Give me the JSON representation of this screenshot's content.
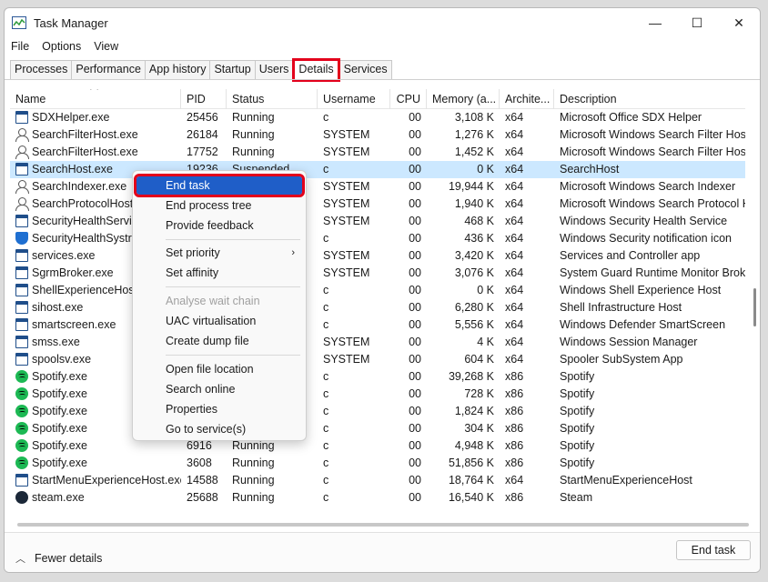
{
  "window": {
    "title": "Task Manager",
    "minimize": "—",
    "maximize": "☐",
    "close": "✕"
  },
  "menu": [
    "File",
    "Options",
    "View"
  ],
  "tabs": [
    "Processes",
    "Performance",
    "App history",
    "Startup",
    "Users",
    "Details",
    "Services"
  ],
  "active_tab": "Details",
  "columns": [
    "Name",
    "PID",
    "Status",
    "Username",
    "CPU",
    "Memory (a...",
    "Archite...",
    "Description"
  ],
  "rows": [
    {
      "icon": "app",
      "name": "SDXHelper.exe",
      "pid": "25456",
      "status": "Running",
      "user": "c",
      "cpu": "00",
      "mem": "3,108 K",
      "arch": "x64",
      "desc": "Microsoft Office SDX Helper"
    },
    {
      "icon": "user",
      "name": "SearchFilterHost.exe",
      "pid": "26184",
      "status": "Running",
      "user": "SYSTEM",
      "cpu": "00",
      "mem": "1,276 K",
      "arch": "x64",
      "desc": "Microsoft Windows Search Filter Host"
    },
    {
      "icon": "user",
      "name": "SearchFilterHost.exe",
      "pid": "17752",
      "status": "Running",
      "user": "SYSTEM",
      "cpu": "00",
      "mem": "1,452 K",
      "arch": "x64",
      "desc": "Microsoft Windows Search Filter Host"
    },
    {
      "icon": "app",
      "name": "SearchHost.exe",
      "pid": "19236",
      "status": "Suspended",
      "user": "c",
      "cpu": "00",
      "mem": "0 K",
      "arch": "x64",
      "desc": "SearchHost",
      "selected": true
    },
    {
      "icon": "user",
      "name": "SearchIndexer.exe",
      "pid": "",
      "status": "",
      "user": "SYSTEM",
      "cpu": "00",
      "mem": "19,944 K",
      "arch": "x64",
      "desc": "Microsoft Windows Search Indexer"
    },
    {
      "icon": "user",
      "name": "SearchProtocolHost.e",
      "pid": "",
      "status": "",
      "user": "SYSTEM",
      "cpu": "00",
      "mem": "1,940 K",
      "arch": "x64",
      "desc": "Microsoft Windows Search Protocol Ho"
    },
    {
      "icon": "app",
      "name": "SecurityHealthService",
      "pid": "",
      "status": "",
      "user": "SYSTEM",
      "cpu": "00",
      "mem": "468 K",
      "arch": "x64",
      "desc": "Windows Security Health Service"
    },
    {
      "icon": "shield",
      "name": "SecurityHealthSystray",
      "pid": "",
      "status": "",
      "user": "c",
      "cpu": "00",
      "mem": "436 K",
      "arch": "x64",
      "desc": "Windows Security notification icon"
    },
    {
      "icon": "app",
      "name": "services.exe",
      "pid": "",
      "status": "",
      "user": "SYSTEM",
      "cpu": "00",
      "mem": "3,420 K",
      "arch": "x64",
      "desc": "Services and Controller app"
    },
    {
      "icon": "app",
      "name": "SgrmBroker.exe",
      "pid": "",
      "status": "",
      "user": "SYSTEM",
      "cpu": "00",
      "mem": "3,076 K",
      "arch": "x64",
      "desc": "System Guard Runtime Monitor Broker"
    },
    {
      "icon": "app",
      "name": "ShellExperienceHost.e",
      "pid": "",
      "status": "",
      "user": "c",
      "cpu": "00",
      "mem": "0 K",
      "arch": "x64",
      "desc": "Windows Shell Experience Host"
    },
    {
      "icon": "app",
      "name": "sihost.exe",
      "pid": "",
      "status": "",
      "user": "c",
      "cpu": "00",
      "mem": "6,280 K",
      "arch": "x64",
      "desc": "Shell Infrastructure Host"
    },
    {
      "icon": "app",
      "name": "smartscreen.exe",
      "pid": "",
      "status": "",
      "user": "c",
      "cpu": "00",
      "mem": "5,556 K",
      "arch": "x64",
      "desc": "Windows Defender SmartScreen"
    },
    {
      "icon": "app",
      "name": "smss.exe",
      "pid": "",
      "status": "",
      "user": "SYSTEM",
      "cpu": "00",
      "mem": "4 K",
      "arch": "x64",
      "desc": "Windows Session Manager"
    },
    {
      "icon": "app",
      "name": "spoolsv.exe",
      "pid": "",
      "status": "",
      "user": "SYSTEM",
      "cpu": "00",
      "mem": "604 K",
      "arch": "x64",
      "desc": "Spooler SubSystem App"
    },
    {
      "icon": "spotify",
      "name": "Spotify.exe",
      "pid": "",
      "status": "",
      "user": "c",
      "cpu": "00",
      "mem": "39,268 K",
      "arch": "x86",
      "desc": "Spotify"
    },
    {
      "icon": "spotify",
      "name": "Spotify.exe",
      "pid": "",
      "status": "",
      "user": "c",
      "cpu": "00",
      "mem": "728 K",
      "arch": "x86",
      "desc": "Spotify"
    },
    {
      "icon": "spotify",
      "name": "Spotify.exe",
      "pid": "",
      "status": "",
      "user": "c",
      "cpu": "00",
      "mem": "1,824 K",
      "arch": "x86",
      "desc": "Spotify"
    },
    {
      "icon": "spotify",
      "name": "Spotify.exe",
      "pid": "",
      "status": "",
      "user": "c",
      "cpu": "00",
      "mem": "304 K",
      "arch": "x86",
      "desc": "Spotify"
    },
    {
      "icon": "spotify",
      "name": "Spotify.exe",
      "pid": "6916",
      "status": "Running",
      "user": "c",
      "cpu": "00",
      "mem": "4,948 K",
      "arch": "x86",
      "desc": "Spotify"
    },
    {
      "icon": "spotify",
      "name": "Spotify.exe",
      "pid": "3608",
      "status": "Running",
      "user": "c",
      "cpu": "00",
      "mem": "51,856 K",
      "arch": "x86",
      "desc": "Spotify"
    },
    {
      "icon": "app",
      "name": "StartMenuExperienceHost.exe",
      "pid": "14588",
      "status": "Running",
      "user": "c",
      "cpu": "00",
      "mem": "18,764 K",
      "arch": "x64",
      "desc": "StartMenuExperienceHost"
    },
    {
      "icon": "steam",
      "name": "steam.exe",
      "pid": "25688",
      "status": "Running",
      "user": "c",
      "cpu": "00",
      "mem": "16,540 K",
      "arch": "x86",
      "desc": "Steam"
    }
  ],
  "context_menu": {
    "end_task": "End task",
    "end_process_tree": "End process tree",
    "provide_feedback": "Provide feedback",
    "set_priority": "Set priority",
    "set_affinity": "Set affinity",
    "analyse_wait_chain": "Analyse wait chain",
    "uac_virtualisation": "UAC virtualisation",
    "create_dump_file": "Create dump file",
    "open_file_location": "Open file location",
    "search_online": "Search online",
    "properties": "Properties",
    "go_to_services": "Go to service(s)",
    "submenu_arrow": "›"
  },
  "footer": {
    "fewer_details": "Fewer details",
    "end_task_button": "End task",
    "chevron": "︿"
  },
  "colors": {
    "highlight_outline": "#e3001b",
    "selected_row": "#cce8ff",
    "menu_highlight": "#1f5ec8"
  }
}
